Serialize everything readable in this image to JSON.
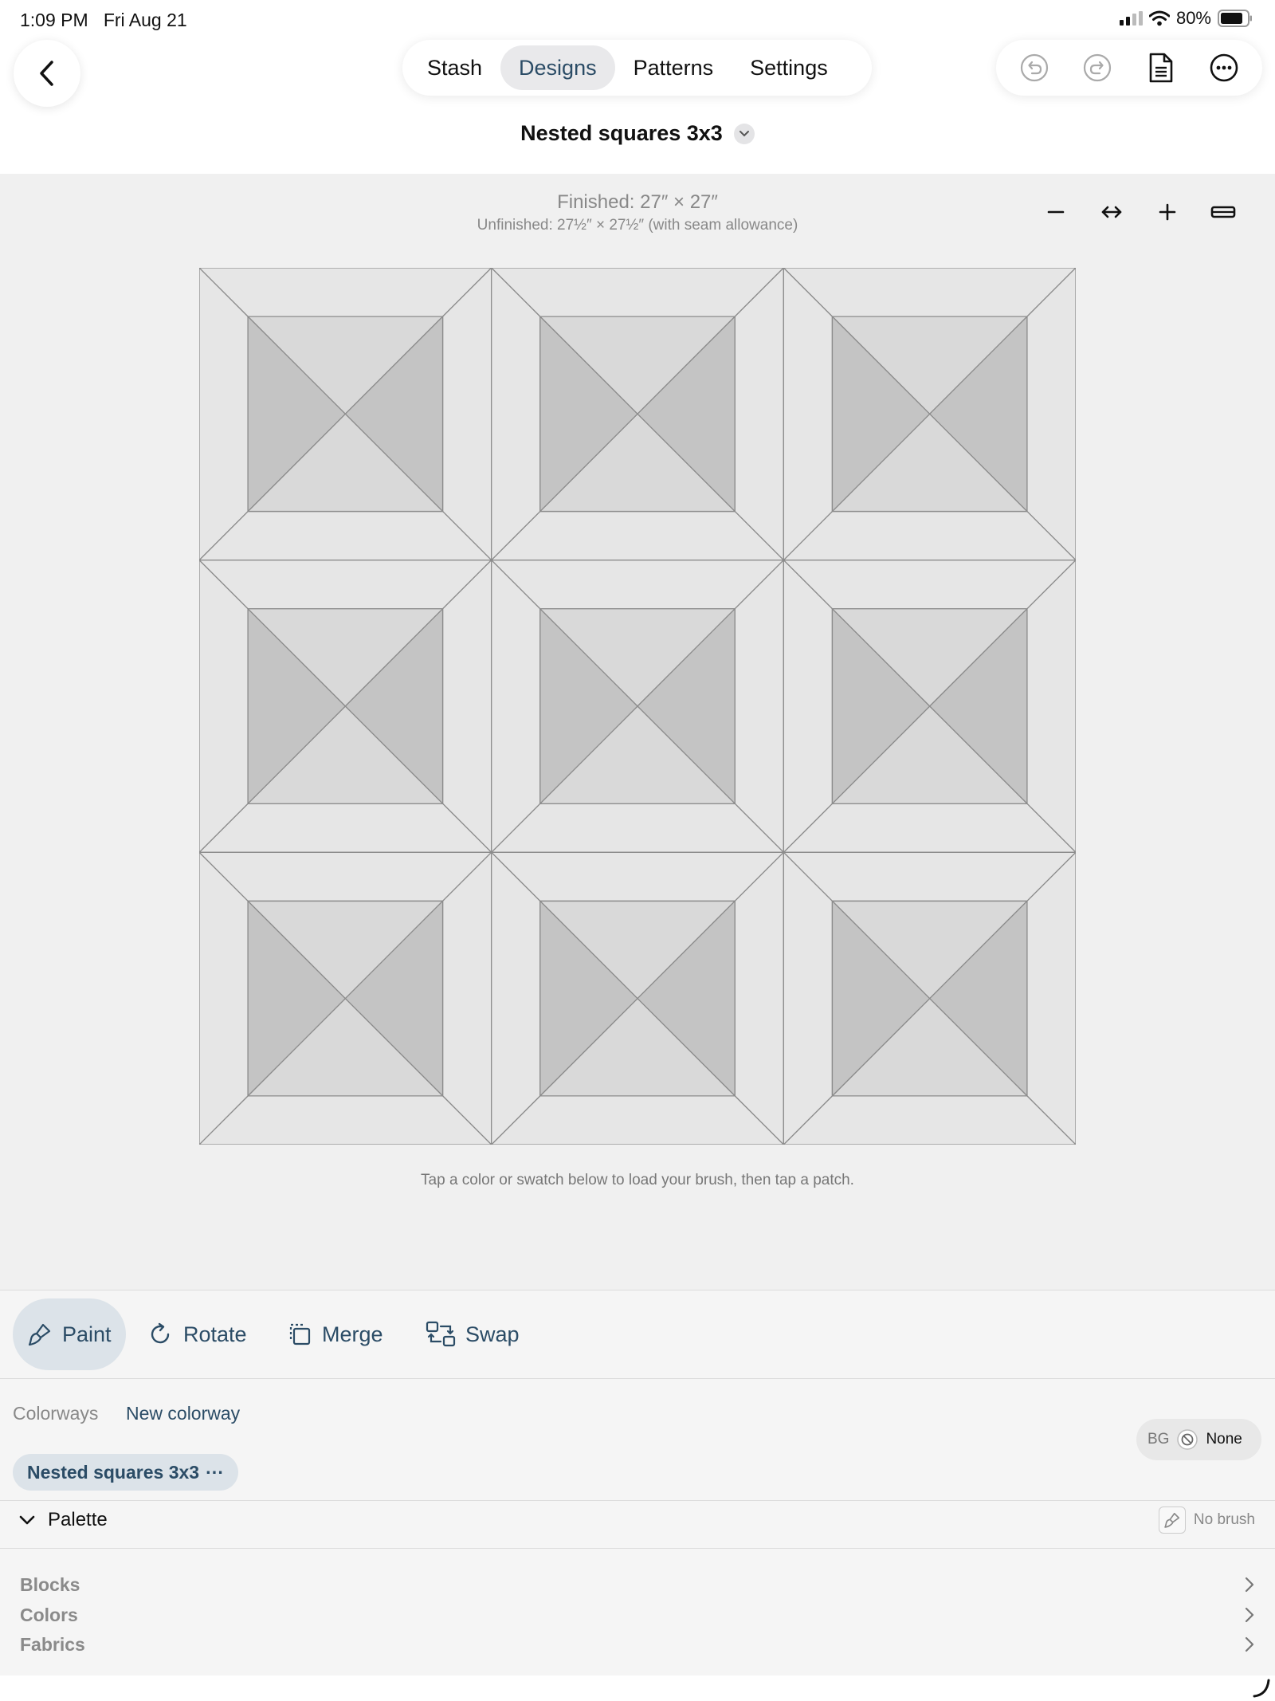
{
  "status": {
    "time": "1:09 PM",
    "date": "Fri Aug 21",
    "battery": "80%"
  },
  "tabs": [
    {
      "label": "Stash",
      "active": false
    },
    {
      "label": "Designs",
      "active": true
    },
    {
      "label": "Patterns",
      "active": false
    },
    {
      "label": "Settings",
      "active": false
    }
  ],
  "design": {
    "title": "Nested squares 3x3"
  },
  "size": {
    "finished": "Finished: 27″ × 27″",
    "unfinished": "Unfinished: 27½″ × 27½″ (with seam allowance)"
  },
  "hint": "Tap a color or swatch below to load your brush, then tap a patch.",
  "modes": [
    {
      "label": "Paint",
      "active": true
    },
    {
      "label": "Rotate",
      "active": false
    },
    {
      "label": "Merge",
      "active": false
    },
    {
      "label": "Swap",
      "active": false
    }
  ],
  "colorways": {
    "label": "Colorways",
    "new_label": "New colorway",
    "current": "Nested squares 3x3",
    "current_more": "···"
  },
  "bg": {
    "label": "BG",
    "value": "None"
  },
  "palette": {
    "label": "Palette",
    "brush": "No brush",
    "sections": [
      "Blocks",
      "Colors",
      "Fabrics"
    ]
  },
  "colors": {
    "accent": "#2b4c66",
    "patch_light": "#e6e6e6",
    "patch_mid": "#d9d9d9",
    "patch_dark": "#c4c4c4",
    "seam": "#8c8c8c"
  },
  "quilt": {
    "rows": 3,
    "cols": 3
  }
}
